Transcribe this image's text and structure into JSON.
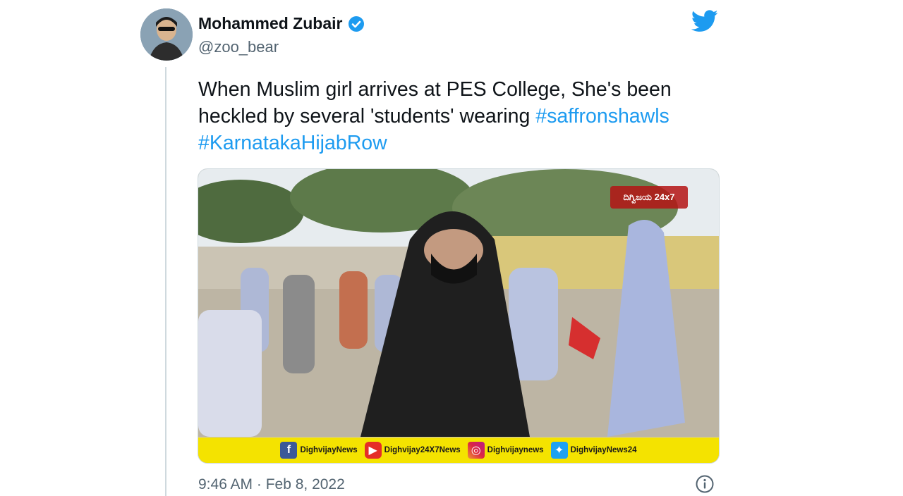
{
  "author": {
    "name": "Mohammed Zubair",
    "handle": "@zoo_bear",
    "verified": true,
    "avatar_icon": "avatar-photo"
  },
  "tweet": {
    "text_plain": "When Muslim girl arrives at PES College, She's been heckled by several 'students' wearing ",
    "hashtag_1": "#saffronshawls",
    "hashtag_2": "#KarnatakaHijabRow",
    "timestamp": "9:46 AM · Feb 8, 2022"
  },
  "media": {
    "channel_watermark": "ದಿಗ್ವಿಜಯ 24x7",
    "banner": [
      {
        "icon": "facebook-icon",
        "label": "DighvijayNews"
      },
      {
        "icon": "youtube-icon",
        "label": "Dighvijay24X7News"
      },
      {
        "icon": "instagram-icon",
        "label": "Dighvijaynews"
      },
      {
        "icon": "twitter-icon",
        "label": "DighvijayNews24"
      }
    ]
  },
  "colors": {
    "link": "#1d9bf0",
    "secondary_text": "#536471",
    "banner_yellow": "#f4e300"
  }
}
